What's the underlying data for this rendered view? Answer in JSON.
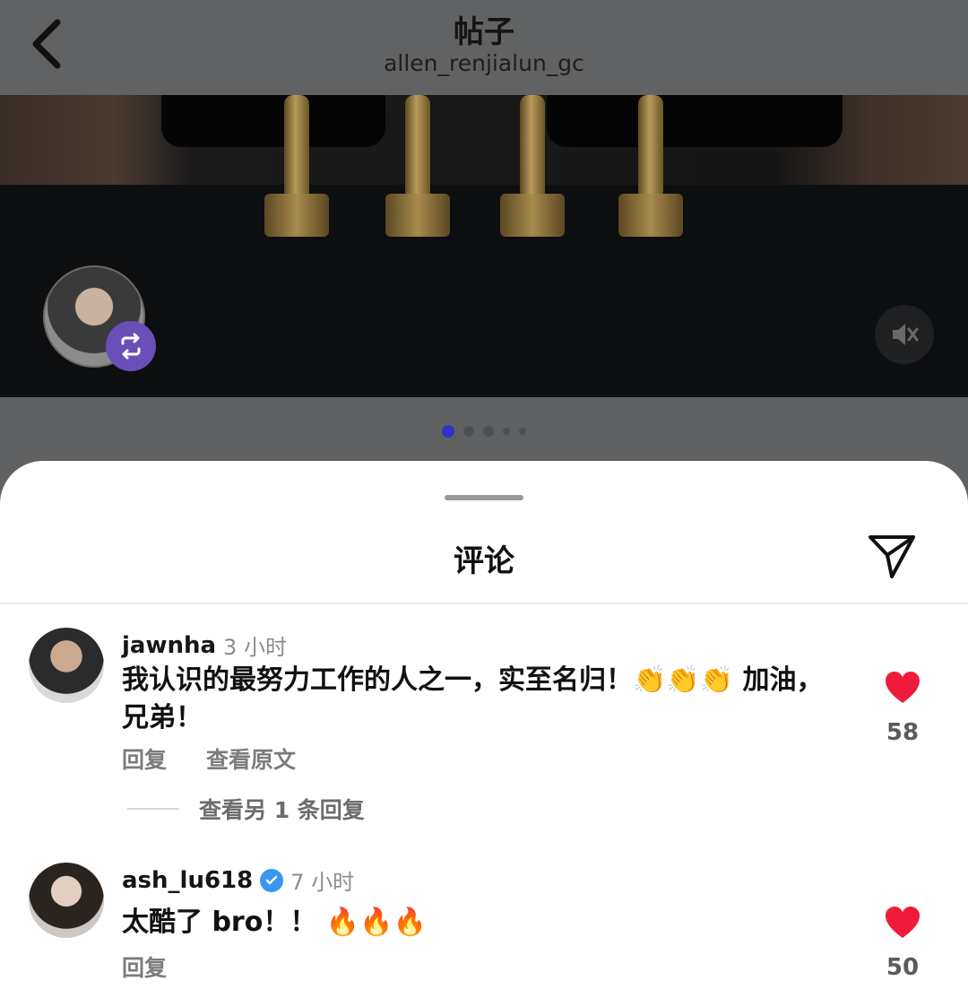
{
  "header": {
    "title": "帖子",
    "username": "allen_renjialun_gc"
  },
  "comments_sheet": {
    "title": "评论",
    "comments": [
      {
        "username": "jawnha",
        "time": "3 小时",
        "text": "我认识的最努力工作的人之一，实至名归！👏👏👏 加油，兄弟！",
        "reply_label": "回复",
        "see_original_label": "查看原文",
        "likes": "58",
        "more_replies": "查看另 1 条回复"
      },
      {
        "username": "ash_lu618",
        "time": "7 小时",
        "text": "太酷了 bro！！ 🔥🔥🔥",
        "reply_label": "回复",
        "likes": "50",
        "verified": true
      }
    ]
  },
  "carousel": {
    "count": 5,
    "active_index": 0
  },
  "colors": {
    "accent": "#2e33c8",
    "like": "#ee1c3a",
    "verified": "#3897f0",
    "repost_badge": "#6a4fb8"
  },
  "icons": [
    "chevron-left-icon",
    "repost-icon",
    "speaker-muted-icon",
    "share-icon",
    "heart-icon",
    "verified-icon"
  ]
}
